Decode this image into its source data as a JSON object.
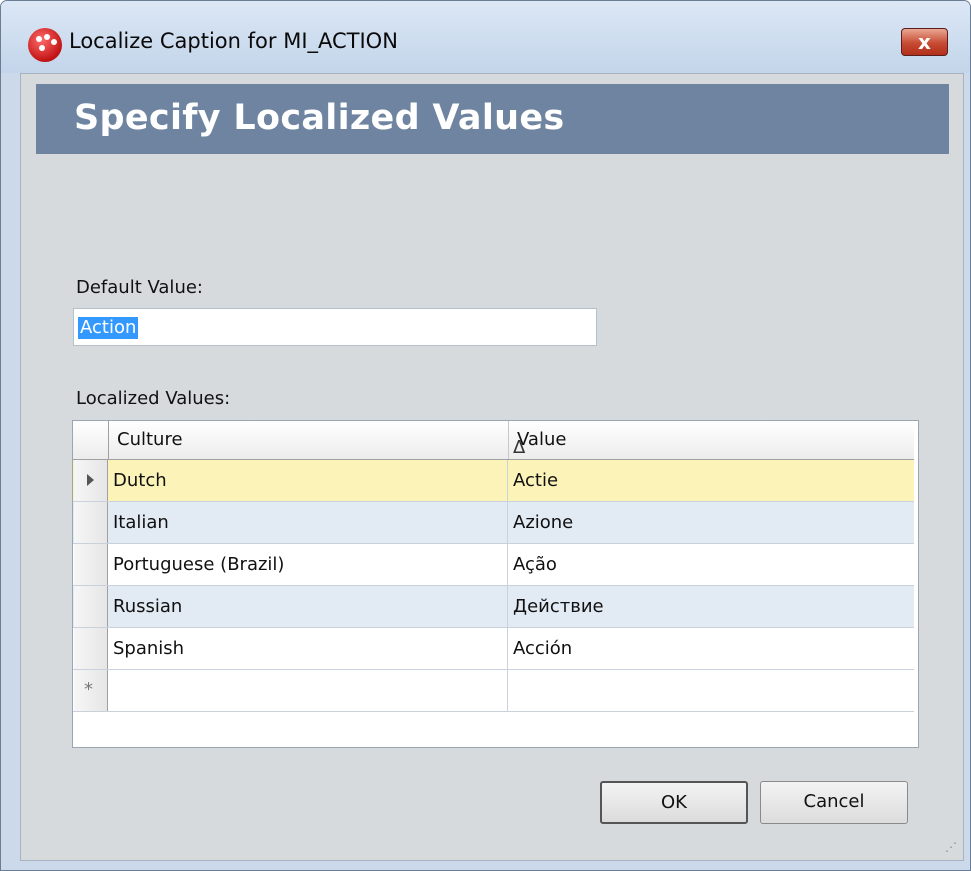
{
  "window": {
    "title": "Localize Caption for MI_ACTION",
    "close_label": "x"
  },
  "header": {
    "title": "Specify Localized Values"
  },
  "default_value": {
    "label": "Default Value:",
    "value": "Action"
  },
  "localized_values": {
    "label": "Localized Values:",
    "columns": [
      "Culture",
      "Value"
    ],
    "sort_indicator": "Δ",
    "rows": [
      {
        "culture": "Dutch",
        "value": "Actie"
      },
      {
        "culture": "Italian",
        "value": "Azione"
      },
      {
        "culture": "Portuguese (Brazil)",
        "value": "Ação"
      },
      {
        "culture": "Russian",
        "value": "Действие"
      },
      {
        "culture": "Spanish",
        "value": "Acción"
      }
    ],
    "new_row_marker": "*"
  },
  "buttons": {
    "ok": "OK",
    "cancel": "Cancel"
  }
}
